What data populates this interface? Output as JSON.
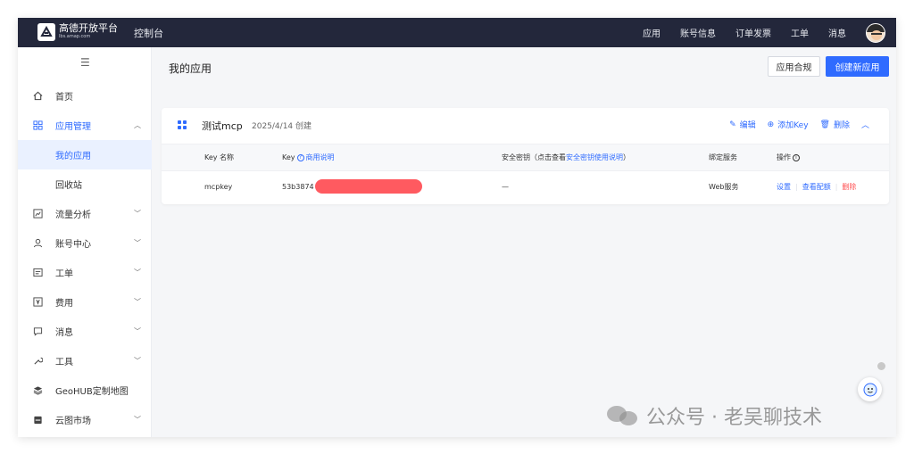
{
  "header": {
    "logo_title": "高德开放平台",
    "logo_subtitle": "lbs.amap.com",
    "console_label": "控制台",
    "nav": [
      "应用",
      "账号信息",
      "订单发票",
      "工单",
      "消息"
    ]
  },
  "sidebar": {
    "items": [
      {
        "label": "首页",
        "icon": "home-icon"
      },
      {
        "label": "应用管理",
        "icon": "apps-grid-icon",
        "expanded": true,
        "children": [
          {
            "label": "我的应用",
            "active": true
          },
          {
            "label": "回收站"
          }
        ]
      },
      {
        "label": "流量分析",
        "icon": "chart-icon"
      },
      {
        "label": "账号中心",
        "icon": "user-icon"
      },
      {
        "label": "工单",
        "icon": "ticket-icon"
      },
      {
        "label": "费用",
        "icon": "yen-icon"
      },
      {
        "label": "消息",
        "icon": "message-icon"
      },
      {
        "label": "工具",
        "icon": "wrench-icon"
      },
      {
        "label": "GeoHUB定制地图",
        "icon": "layers-icon"
      },
      {
        "label": "云图市场",
        "icon": "store-icon"
      }
    ]
  },
  "main": {
    "title": "我的应用",
    "btn_compliance": "应用合规",
    "btn_create": "创建新应用",
    "app": {
      "name": "测试mcp",
      "created": "2025/4/14 创建",
      "actions": {
        "edit": "编辑",
        "add_key": "添加Key",
        "delete": "删除"
      },
      "columns": {
        "key_name": "Key 名称",
        "key": "Key",
        "key_doc": "商用说明",
        "secret_prefix": "安全密钥（点击查看",
        "secret_link": "安全密钥使用说明",
        "secret_suffix": "）",
        "service": "绑定服务",
        "ops": "操作"
      },
      "rows": [
        {
          "name": "mcpkey",
          "key_visible": "53b3874",
          "secret": "—",
          "service": "Web服务",
          "ops": [
            "设置",
            "查看配额",
            "删除"
          ]
        }
      ]
    }
  },
  "watermark": "公众号 · 老吴聊技术",
  "colors": {
    "accent": "#2f6bff",
    "topbar": "#23273b",
    "danger": "#ff4d4f",
    "redaction": "#ff5a60"
  }
}
